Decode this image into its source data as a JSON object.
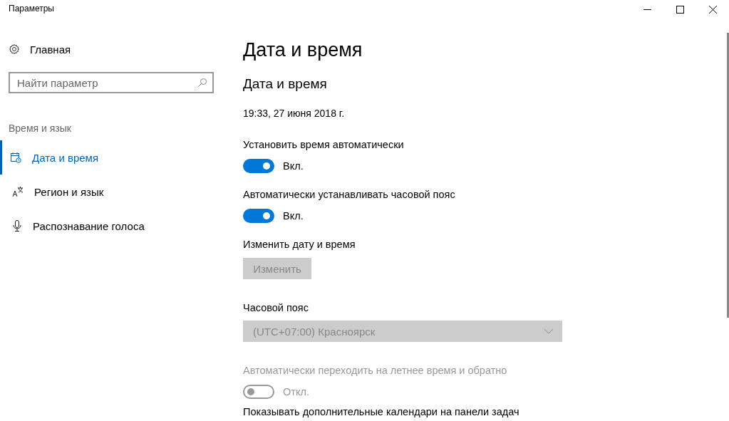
{
  "window": {
    "title": "Параметры"
  },
  "sidebar": {
    "home": "Главная",
    "search": {
      "placeholder": "Найти параметр"
    },
    "group": "Время и язык",
    "items": [
      {
        "label": "Дата и время",
        "selected": true,
        "kind": "calendar"
      },
      {
        "label": "Регион и язык",
        "selected": false,
        "kind": "language"
      },
      {
        "label": "Распознавание голоса",
        "selected": false,
        "kind": "microphone"
      }
    ]
  },
  "content": {
    "title": "Дата и время",
    "section_title": "Дата и время",
    "current_time": "19:33, 27 июня 2018 г.",
    "settings": [
      {
        "kind": "toggle",
        "label": "Установить время автоматически",
        "on": true,
        "disabled": false,
        "state_text": "Вкл."
      },
      {
        "kind": "toggle",
        "label": "Автоматически устанавливать часовой пояс",
        "on": true,
        "disabled": false,
        "state_text": "Вкл."
      },
      {
        "kind": "button",
        "label": "Изменить дату и время",
        "button": "Изменить",
        "disabled": true
      },
      {
        "kind": "dropdown",
        "label": "Часовой пояс",
        "value": "(UTC+07:00) Красноярск",
        "disabled": true
      },
      {
        "kind": "toggle",
        "label": "Автоматически переходить на летнее время и обратно",
        "on": false,
        "disabled": true,
        "state_text": "Откл."
      },
      {
        "kind": "heading",
        "label": "Показывать дополнительные календари на панели задач"
      }
    ]
  }
}
